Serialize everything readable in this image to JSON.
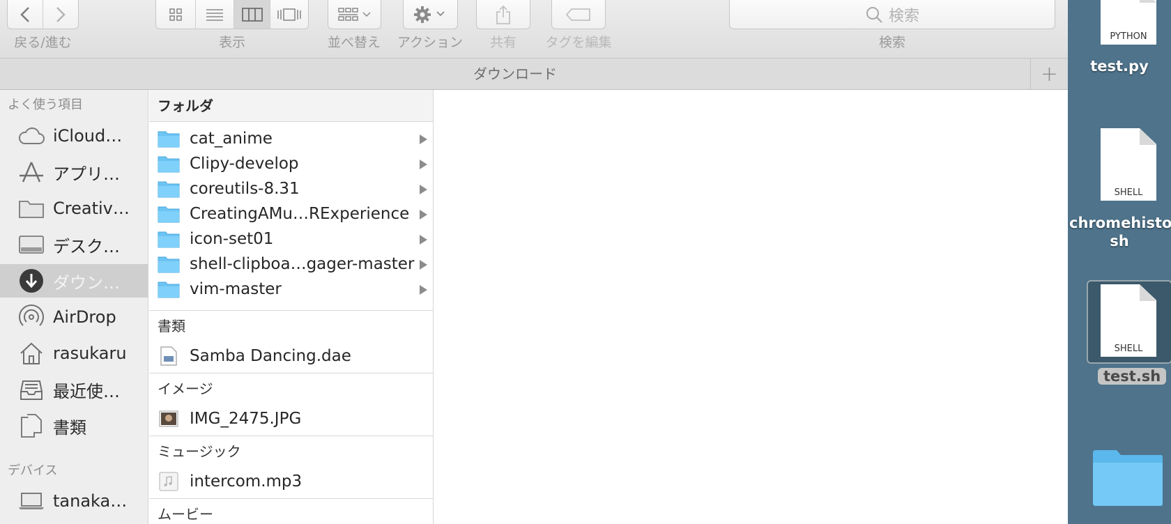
{
  "toolbar": {
    "nav_label": "戻る/進む",
    "view_label": "表示",
    "arrange_label": "並べ替え",
    "action_label": "アクション",
    "share_label": "共有",
    "tags_label": "タグを編集",
    "search_label": "検索",
    "search_placeholder": "検索"
  },
  "tab": {
    "title": "ダウンロード",
    "add_symbol": "+"
  },
  "sidebar": {
    "favorites_header": "よく使う項目",
    "devices_header": "デバイス",
    "items": [
      {
        "label": "iCloud…",
        "icon": "cloud-icon"
      },
      {
        "label": "アプリ…",
        "icon": "applications-icon"
      },
      {
        "label": "Creativ…",
        "icon": "folder-icon"
      },
      {
        "label": "デスク…",
        "icon": "desktop-icon"
      },
      {
        "label": "ダウン…",
        "icon": "download-icon",
        "selected": true
      },
      {
        "label": "AirDrop",
        "icon": "airdrop-icon"
      },
      {
        "label": "rasukaru",
        "icon": "home-icon"
      },
      {
        "label": "最近使…",
        "icon": "recents-icon"
      },
      {
        "label": "書類",
        "icon": "documents-icon"
      }
    ],
    "devices": [
      {
        "label": "tanaka…",
        "icon": "laptop-icon"
      }
    ]
  },
  "column1": {
    "sections": [
      {
        "title": "フォルダ",
        "items": [
          "cat_anime",
          "Clipy-develop",
          "coreutils-8.31",
          "CreatingAMu…RExperience",
          "icon-set01",
          "shell-clipboa…gager-master",
          "vim-master"
        ]
      },
      {
        "title": "書類",
        "items": [
          "Samba Dancing.dae"
        ]
      },
      {
        "title": "イメージ",
        "items": [
          "IMG_2475.JPG"
        ]
      },
      {
        "title": "ミュージック",
        "items": [
          "intercom.mp3"
        ]
      },
      {
        "title": "ムービー",
        "items": []
      }
    ]
  },
  "desktop": {
    "items": [
      {
        "name": "test.py",
        "type": "PYTHON"
      },
      {
        "name": "chromehistor",
        "name_line2": "sh",
        "type": "SHELL"
      },
      {
        "name": "test.sh",
        "type": "SHELL",
        "selected": true
      },
      {
        "name": "",
        "type": "folder"
      }
    ]
  },
  "colors": {
    "folder": "#6cc4f3",
    "selection": "#cfcfcf",
    "desktop_bg": "#4e738b"
  }
}
